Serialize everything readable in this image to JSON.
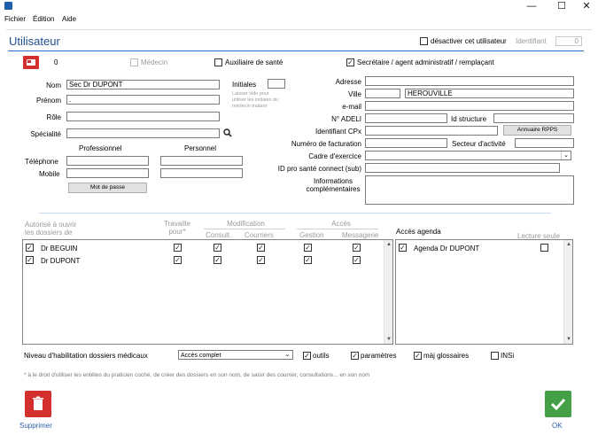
{
  "titlebar": {
    "minimize": "—",
    "maximize": "☐",
    "close": "✕"
  },
  "menu": [
    "Fichier",
    "Édition",
    "Aide"
  ],
  "header": {
    "title": "Utilisateur",
    "deactivate_label": "désactiver cet utilisateur",
    "identifiant_label": "Identifiant",
    "identifiant_value": "0"
  },
  "user": {
    "id": "0",
    "medecin_label": "Médecin",
    "auxiliaire_label": "Auxiliaire de santé",
    "secretaire_label": "Secrétaire / agent administratif / remplaçant"
  },
  "identity": {
    "nom_label": "Nom",
    "nom_value": "Sec Dr DUPONT",
    "prenom_label": "Prénom",
    "prenom_value": ".",
    "role_label": "Rôle",
    "role_value": "",
    "specialite_label": "Spécialité",
    "specialite_value": "",
    "initiales_label": "Initiales",
    "initiales_value": "",
    "initiales_hint_1": "Laisser vide pour",
    "initiales_hint_2": "utiliser les initiales du",
    "initiales_hint_3": "médecin traitant"
  },
  "contact": {
    "professionnel_header": "Professionnel",
    "personnel_header": "Personnel",
    "telephone_label": "Téléphone",
    "mobile_label": "Mobile",
    "password_button": "Mot de passe"
  },
  "address": {
    "adresse_label": "Adresse",
    "adresse_value": "",
    "ville_label": "Ville",
    "cp_value": "",
    "ville_value": "HEROUVILLE",
    "email_label": "e-mail",
    "email_value": "",
    "adeli_label": "N° ADELI",
    "adeli_value": "",
    "id_structure_label": "Id structure",
    "id_structure_value": "",
    "cpx_label": "Identifiant CPx",
    "cpx_value": "",
    "rpps_button": "Annuaire RPPS",
    "facturation_label": "Numéro de facturation",
    "facturation_value": "",
    "secteur_label": "Secteur d'activité",
    "secteur_value": "",
    "cadre_label": "Cadre d'exercice",
    "cadre_value": "",
    "psc_label": "ID pro santé connect (sub)",
    "psc_value": "",
    "infos_label_1": "Informations",
    "infos_label_2": "complémentaires",
    "infos_value": ""
  },
  "permissions": {
    "autorise_label_1": "Autorisé à ouvrir",
    "autorise_label_2": "les dossiers de",
    "travaille_label_1": "Travaille",
    "travaille_label_2": "pour*",
    "modification_label": "Modification",
    "consult_label": "Consult.",
    "courriers_label": "Courriers",
    "acces_label": "Accès",
    "gestion_label": "Gestion",
    "messagerie_label": "Messagerie",
    "rows": [
      {
        "name": "Dr BEGUIN",
        "checked": true,
        "travaille": true,
        "consult": true,
        "courriers": true,
        "gestion": true,
        "messagerie": true
      },
      {
        "name": "Dr DUPONT",
        "checked": true,
        "travaille": true,
        "consult": true,
        "courriers": true,
        "gestion": true,
        "messagerie": true
      }
    ]
  },
  "agenda": {
    "title": "Accès agenda",
    "lecture_seule_label": "Lecture seule",
    "rows": [
      {
        "name": "Agenda Dr DUPONT",
        "checked": true,
        "lecture_seule": false
      }
    ]
  },
  "habilitation": {
    "label": "Niveau d'habilitation dossiers médicaux",
    "value": "Accès complet",
    "outils_label": "outils",
    "parametres_label": "paramètres",
    "glossaires_label": "màj glossaires",
    "insi_label": "INSi"
  },
  "footnote": "* à le droit d'utiliser les entêtes du praticien coché, de créer des dossiers en son nom, de saisir des courrier, consultations... en son nom",
  "footer": {
    "delete_label": "Supprimer",
    "ok_label": "OK"
  },
  "colors": {
    "accent": "#1f4e8c",
    "delete": "#d32f2f",
    "ok": "#43a047"
  }
}
